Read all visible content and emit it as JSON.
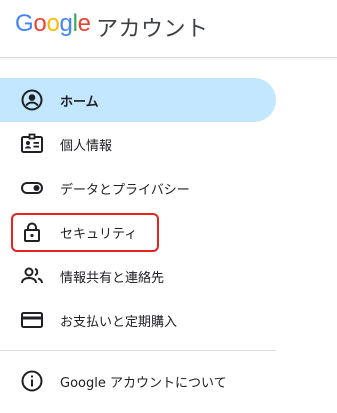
{
  "header": {
    "logo": {
      "G": "G",
      "o1": "o",
      "o2": "o",
      "g": "g",
      "l": "l",
      "e": "e"
    },
    "product": "アカウント"
  },
  "nav": {
    "items": [
      {
        "label": "ホーム",
        "icon": "account-circle-icon",
        "active": true
      },
      {
        "label": "個人情報",
        "icon": "badge-icon",
        "active": false
      },
      {
        "label": "データとプライバシー",
        "icon": "toggle-icon",
        "active": false
      },
      {
        "label": "セキュリティ",
        "icon": "lock-icon",
        "active": false
      },
      {
        "label": "情報共有と連絡先",
        "icon": "people-icon",
        "active": false
      },
      {
        "label": "お支払いと定期購入",
        "icon": "credit-card-icon",
        "active": false
      }
    ],
    "about": {
      "label": "Google アカウントについて",
      "icon": "info-icon"
    }
  },
  "colors": {
    "active_background": "#c2e7ff",
    "highlight_border": "#e8231f",
    "text": "#202124",
    "divider": "#dadce0"
  }
}
